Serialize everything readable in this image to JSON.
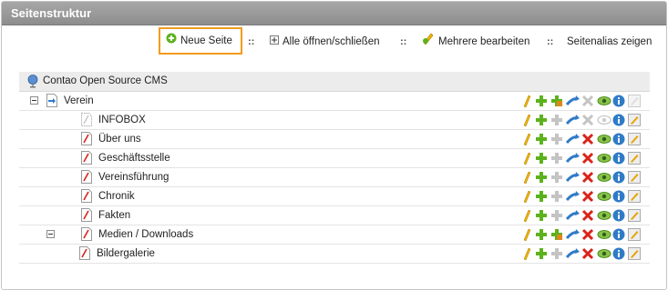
{
  "header": {
    "title": "Seitenstruktur"
  },
  "actions": {
    "new_page": "Neue Seite",
    "toggle_all": "Alle öffnen/schließen",
    "edit_multiple": "Mehrere bearbeiten",
    "page_alias": "Seitenalias zeigen",
    "separator": "::"
  },
  "tree": {
    "root": "Contao Open Source CMS",
    "rows": [
      {
        "label": "Verein",
        "type": "regular"
      },
      {
        "label": "INFOBOX",
        "type": "hidden"
      },
      {
        "label": "Über uns",
        "type": "page"
      },
      {
        "label": "Geschäftsstelle",
        "type": "page"
      },
      {
        "label": "Vereinsführung",
        "type": "page"
      },
      {
        "label": "Chronik",
        "type": "page"
      },
      {
        "label": "Fakten",
        "type": "page"
      },
      {
        "label": "Medien / Downloads",
        "type": "page"
      },
      {
        "label": "Bildergalerie",
        "type": "page"
      }
    ]
  },
  "colors": {
    "title_bar": "#999999",
    "highlight_border": "#f29c1e",
    "add_green": "#5cb21c",
    "delete_red": "#d9231a",
    "info_blue": "#2f7bc8",
    "edit_yellow": "#f0b400"
  }
}
